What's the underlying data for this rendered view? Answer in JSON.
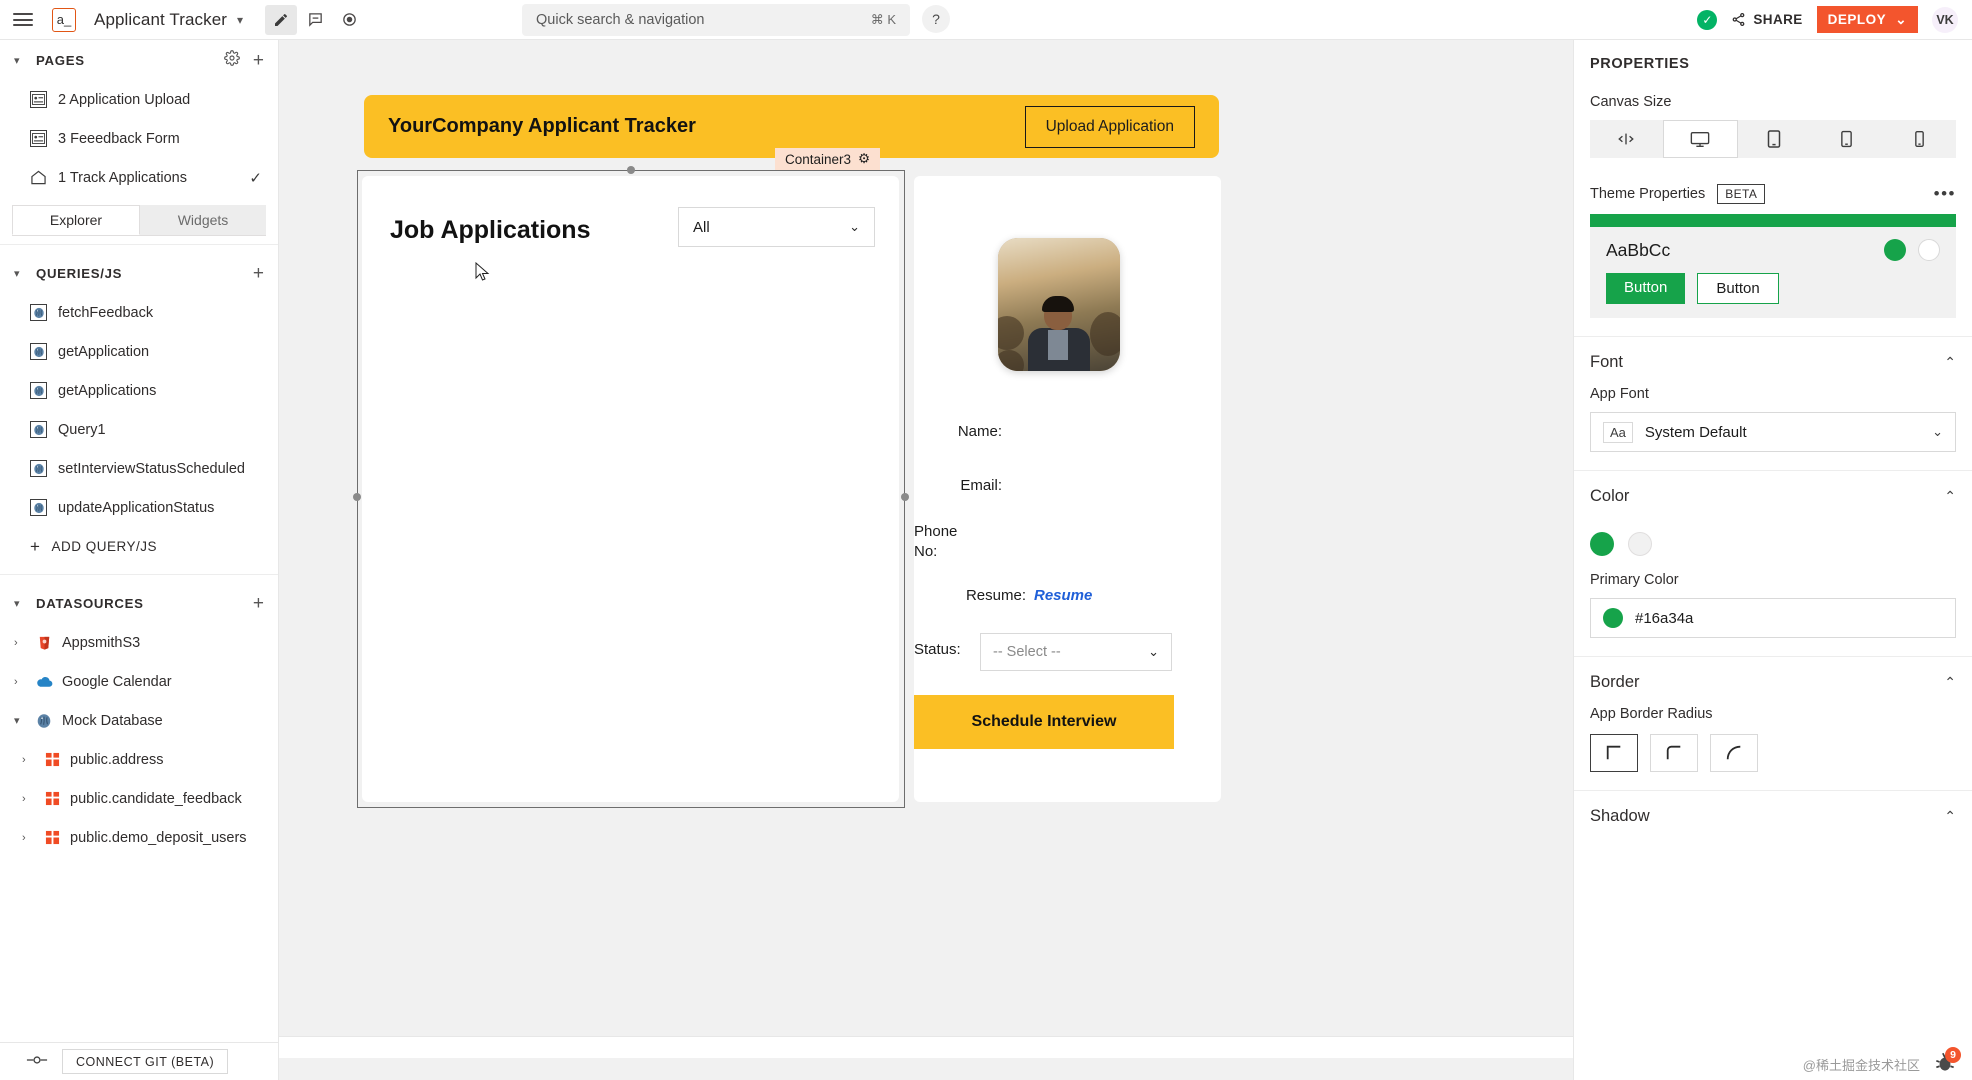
{
  "topbar": {
    "logo_text": "a_",
    "app_title": "Applicant Tracker",
    "search_placeholder": "Quick search & navigation",
    "search_shortcut": "⌘ K",
    "help_label": "?",
    "share_label": "SHARE",
    "deploy_label": "DEPLOY",
    "avatar_initials": "VK",
    "modes": [
      "edit-pencil",
      "comment",
      "preview-eye"
    ]
  },
  "sidebar": {
    "pages_section": {
      "title": "PAGES",
      "items": [
        {
          "label": "2 Application Upload",
          "icon": "page-icon",
          "checked": false
        },
        {
          "label": "3 Feeedback Form",
          "icon": "page-icon",
          "checked": false
        },
        {
          "label": "1 Track Applications",
          "icon": "home-icon",
          "checked": true
        }
      ]
    },
    "tabs": [
      {
        "label": "Explorer",
        "active": true
      },
      {
        "label": "Widgets",
        "active": false
      }
    ],
    "queries_section": {
      "title": "QUERIES/JS",
      "items": [
        {
          "label": "fetchFeedback",
          "icon": "postgres-icon"
        },
        {
          "label": "getApplication",
          "icon": "postgres-icon"
        },
        {
          "label": "getApplications",
          "icon": "postgres-icon"
        },
        {
          "label": "Query1",
          "icon": "postgres-icon"
        },
        {
          "label": "setInterviewStatusScheduled",
          "icon": "postgres-icon"
        },
        {
          "label": "updateApplicationStatus",
          "icon": "postgres-icon"
        }
      ],
      "add_label": "ADD QUERY/JS"
    },
    "datasources_section": {
      "title": "DATASOURCES",
      "items": [
        {
          "label": "AppsmithS3",
          "icon": "s3-icon",
          "expanded": false
        },
        {
          "label": "Google Calendar",
          "icon": "calendar-cloud-icon",
          "expanded": false
        },
        {
          "label": "Mock Database",
          "icon": "postgres-icon",
          "expanded": true
        },
        {
          "label": "public.address",
          "icon": "table-icon",
          "expanded": false,
          "child": true
        },
        {
          "label": "public.candidate_feedback",
          "icon": "table-icon",
          "expanded": false,
          "child": true
        },
        {
          "label": "public.demo_deposit_users",
          "icon": "table-icon",
          "expanded": false,
          "child": true
        }
      ]
    },
    "git_label": "CONNECT GIT (BETA)"
  },
  "canvas": {
    "banner_title": "YourCompany Applicant Tracker",
    "upload_button": "Upload Application",
    "selected_widget_label": "Container3",
    "job_title": "Job Applications",
    "filter_value": "All",
    "details": {
      "name_label": "Name:",
      "email_label": "Email:",
      "phone_label": "Phone No:",
      "resume_label": "Resume:",
      "resume_link": "Resume",
      "status_label": "Status:",
      "status_value": "-- Select --",
      "schedule_button": "Schedule Interview"
    }
  },
  "properties": {
    "title": "PROPERTIES",
    "canvas_size": {
      "label": "Canvas Size",
      "options": [
        "fluid",
        "desktop",
        "tablet-large",
        "tablet",
        "mobile"
      ],
      "selected": "desktop"
    },
    "theme": {
      "label": "Theme Properties",
      "badge": "BETA",
      "preview_text": "AaBbCc",
      "button_primary": "Button",
      "button_secondary": "Button",
      "accent_color": "#16a34a"
    },
    "font": {
      "section_label": "Font",
      "field_label": "App Font",
      "chip": "Aa",
      "value": "System Default"
    },
    "color": {
      "section_label": "Color",
      "primary_label": "Primary Color",
      "primary_value": "#16a34a",
      "swatches": [
        "#16a34a",
        "#f1f1f1"
      ]
    },
    "border": {
      "section_label": "Border",
      "field_label": "App Border Radius",
      "options": [
        "sharp",
        "slight",
        "rounded"
      ],
      "selected": "sharp"
    },
    "shadow": {
      "section_label": "Shadow"
    }
  },
  "footer": {
    "watermark": "@稀土掘金技术社区",
    "debug_count": "9"
  }
}
